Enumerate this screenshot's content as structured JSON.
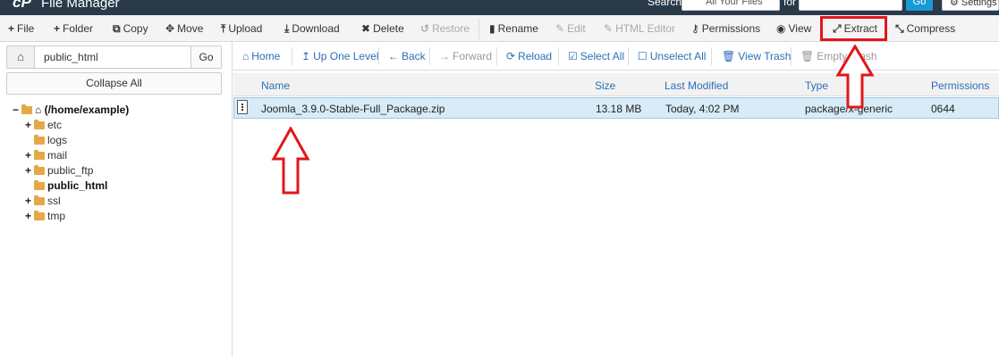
{
  "header": {
    "logo": "cP",
    "title": "File Manager",
    "search_label": "Search",
    "search_scope": "All Your Files",
    "for_label": "for",
    "go_label": "Go",
    "settings_label": "Settings"
  },
  "toolbar": {
    "file": "File",
    "folder": "Folder",
    "copy": "Copy",
    "move": "Move",
    "upload": "Upload",
    "download": "Download",
    "delete": "Delete",
    "restore": "Restore",
    "rename": "Rename",
    "edit": "Edit",
    "html_editor": "HTML Editor",
    "permissions": "Permissions",
    "view": "View",
    "extract": "Extract",
    "compress": "Compress"
  },
  "sidebar": {
    "path_value": "public_html",
    "go_label": "Go",
    "collapse_label": "Collapse All",
    "root_label": "(/home/example)",
    "items": [
      {
        "label": "etc"
      },
      {
        "label": "logs"
      },
      {
        "label": "mail"
      },
      {
        "label": "public_ftp"
      },
      {
        "label": "public_html"
      },
      {
        "label": "ssl"
      },
      {
        "label": "tmp"
      }
    ]
  },
  "nav": {
    "home": "Home",
    "up_one_level": "Up One Level",
    "back": "Back",
    "forward": "Forward",
    "reload": "Reload",
    "select_all": "Select All",
    "unselect_all": "Unselect All",
    "view_trash": "View Trash",
    "empty_trash": "Empty Trash"
  },
  "table": {
    "columns": [
      "Name",
      "Size",
      "Last Modified",
      "Type",
      "Permissions"
    ],
    "rows": [
      {
        "name": "Joomla_3.9.0-Stable-Full_Package.zip",
        "size": "13.18 MB",
        "modified": "Today, 4:02 PM",
        "type": "package/x-generic",
        "permissions": "0644"
      }
    ]
  },
  "colors": {
    "accent": "#2a6fb7",
    "header_bg": "#293a4a",
    "highlight": "#e2161b",
    "selected_row": "#d8ebf8"
  }
}
